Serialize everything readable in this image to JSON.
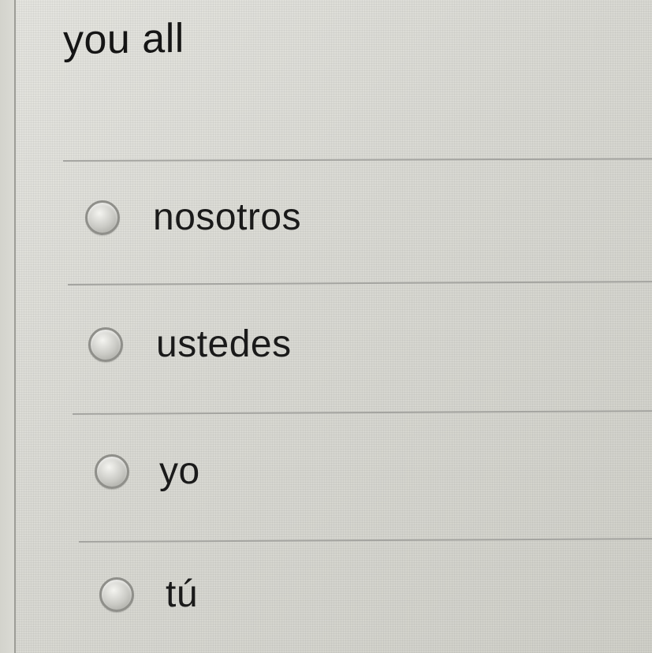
{
  "question": {
    "prompt": "you all"
  },
  "options": [
    {
      "label": "nosotros",
      "selected": false
    },
    {
      "label": "ustedes",
      "selected": false
    },
    {
      "label": "yo",
      "selected": false
    },
    {
      "label": "tú",
      "selected": false
    }
  ]
}
